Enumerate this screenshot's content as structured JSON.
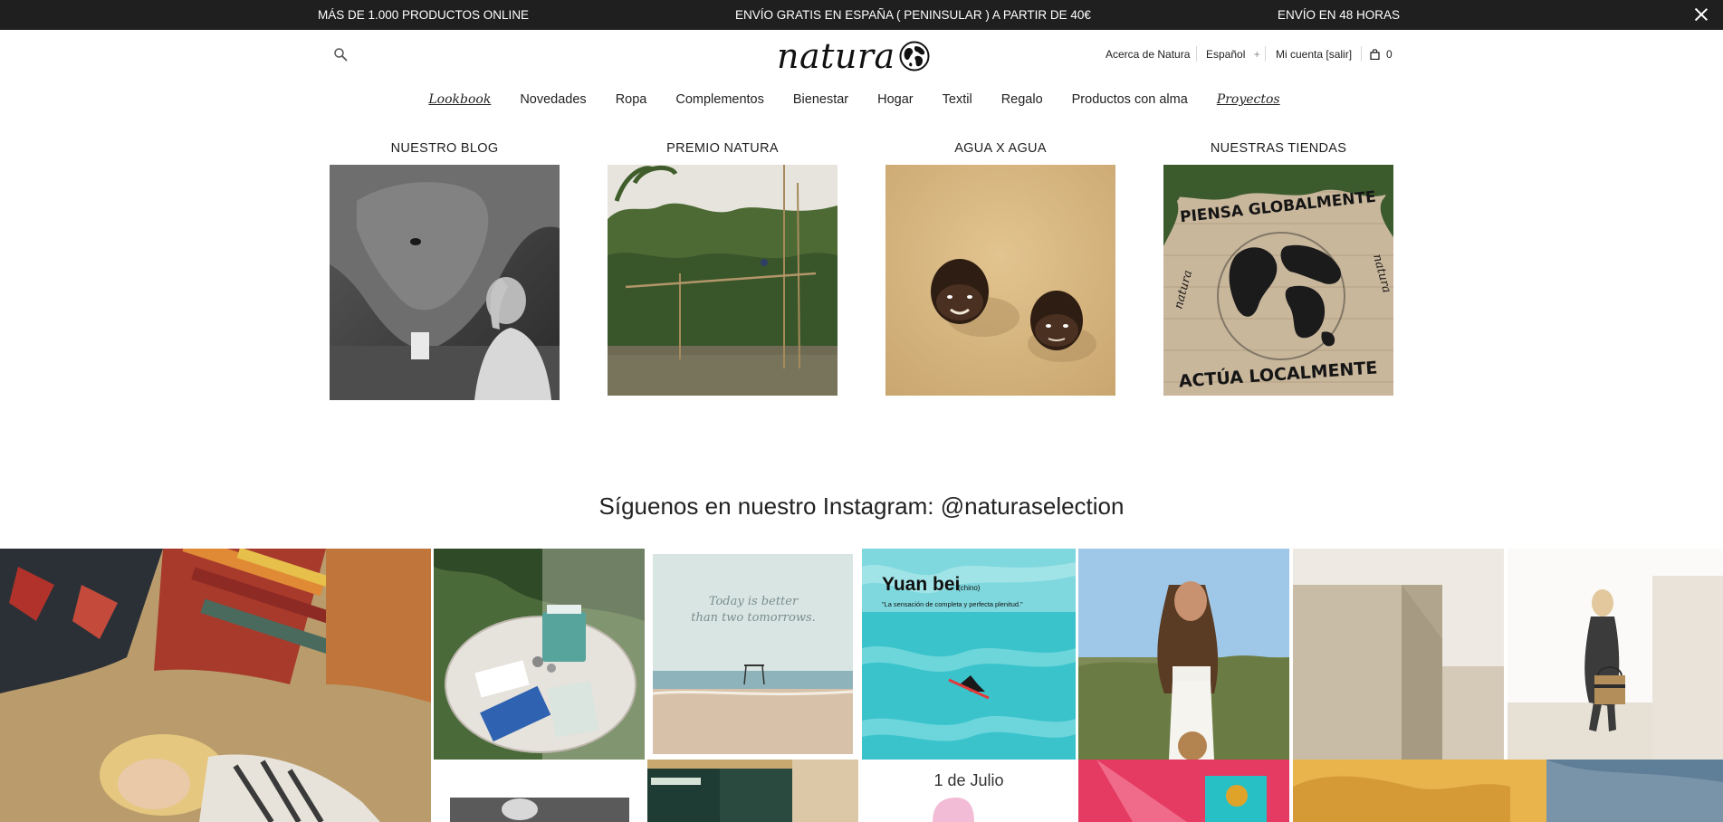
{
  "announcements": {
    "left": "MÁS DE 1.000 PRODUCTOS ONLINE",
    "center": "ENVÍO GRATIS EN ESPAÑA ( PENINSULAR ) A PARTIR DE 40€",
    "right": "ENVÍO EN 48 HORAS",
    "close_icon": "close-icon"
  },
  "header": {
    "logo_text": "natura",
    "search_icon": "search-icon",
    "about": "Acerca de Natura",
    "language": "Español",
    "language_toggle": "+",
    "account": "Mi cuenta [salir]",
    "cart_count": "0",
    "cart_icon": "shopping-bag-icon"
  },
  "nav": {
    "items": [
      "Lookbook",
      "Novedades",
      "Ropa",
      "Complementos",
      "Bienestar",
      "Hogar",
      "Textil",
      "Regalo",
      "Productos con alma",
      "Proyectos"
    ]
  },
  "sections": [
    {
      "title": "NUESTRO BLOG"
    },
    {
      "title": "PREMIO NATURA"
    },
    {
      "title": "AGUA X AGUA"
    },
    {
      "title": "NUESTRAS TIENDAS",
      "sign_top": "PIENSA GLOBALMENTE",
      "sign_bottom": "ACTÚA LOCALMENTE",
      "sign_brand": "natura"
    }
  ],
  "instagram": {
    "title": "Síguenos en nuestro Instagram: @naturaselection",
    "quote_line1": "Today is better",
    "quote_line2": "than two tomorrows.",
    "yuan_title": "Yuan bei",
    "yuan_sub": "(chino)",
    "yuan_caption": "\"La sensación de completa y perfecta plenitud.\"",
    "date_text": "1 de Julio"
  },
  "colors": {
    "topbar_bg": "#1f1f1f",
    "text": "#222222"
  }
}
